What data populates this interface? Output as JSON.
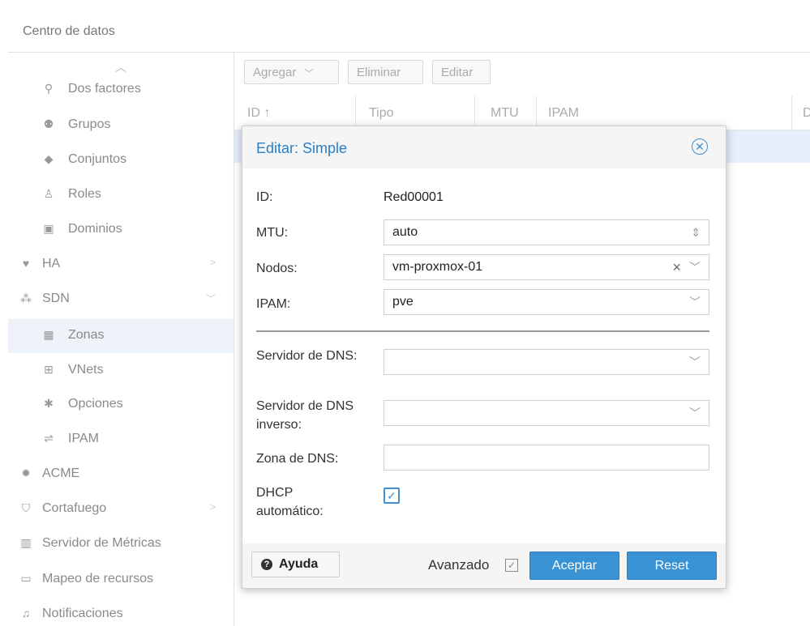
{
  "header": {
    "title": "Centro de datos"
  },
  "sidebar": {
    "items": [
      {
        "label": "Dos factores",
        "icon": "key-icon",
        "glyph": "⚲"
      },
      {
        "label": "Grupos",
        "icon": "users-icon",
        "glyph": "👥"
      },
      {
        "label": "Conjuntos",
        "icon": "tags-icon",
        "glyph": "◆"
      },
      {
        "label": "Roles",
        "icon": "male-icon",
        "glyph": "♙"
      },
      {
        "label": "Dominios",
        "icon": "address-book-icon",
        "glyph": "▣"
      },
      {
        "label": "HA",
        "icon": "heartbeat-icon",
        "glyph": "♥"
      },
      {
        "label": "SDN",
        "icon": "sdn-icon",
        "glyph": "⁂"
      },
      {
        "label": "Zonas",
        "icon": "th-icon",
        "glyph": "▦"
      },
      {
        "label": "VNets",
        "icon": "network-icon",
        "glyph": "⊞"
      },
      {
        "label": "Opciones",
        "icon": "gear-icon",
        "glyph": "✱"
      },
      {
        "label": "IPAM",
        "icon": "ipam-icon",
        "glyph": "⇌"
      },
      {
        "label": "ACME",
        "icon": "certificate-icon",
        "glyph": "✹"
      },
      {
        "label": "Cortafuego",
        "icon": "shield-icon",
        "glyph": "⛉"
      },
      {
        "label": "Servidor de Métricas",
        "icon": "bar-chart-icon",
        "glyph": "▥"
      },
      {
        "label": "Mapeo de recursos",
        "icon": "folder-icon",
        "glyph": "▭"
      },
      {
        "label": "Notificaciones",
        "icon": "bell-icon",
        "glyph": "♫"
      }
    ]
  },
  "toolbar": {
    "add": "Agregar",
    "remove": "Eliminar",
    "edit": "Editar"
  },
  "grid": {
    "columns": [
      "ID ↑",
      "Tipo",
      "MTU",
      "IPAM",
      "D"
    ]
  },
  "dialog": {
    "title": "Editar: Simple",
    "labels": {
      "id": "ID:",
      "mtu": "MTU:",
      "nodes": "Nodos:",
      "ipam": "IPAM:",
      "dns": "Servidor de DNS:",
      "reverse_dns": "Servidor de DNS inverso:",
      "dns_zone": "Zona de DNS:",
      "dhcp": "DHCP automático:"
    },
    "values": {
      "id": "Red00001",
      "mtu": "auto",
      "nodes": "vm-proxmox-01",
      "ipam": "pve",
      "dns": "",
      "reverse_dns": "",
      "dns_zone": "",
      "dhcp_checked": true
    },
    "footer": {
      "help": "Ayuda",
      "advanced": "Avanzado",
      "ok": "Aceptar",
      "reset": "Reset"
    }
  },
  "colors": {
    "accent": "#3892d4",
    "title": "#2a7fc5",
    "selected_row": "#e5eefb"
  }
}
